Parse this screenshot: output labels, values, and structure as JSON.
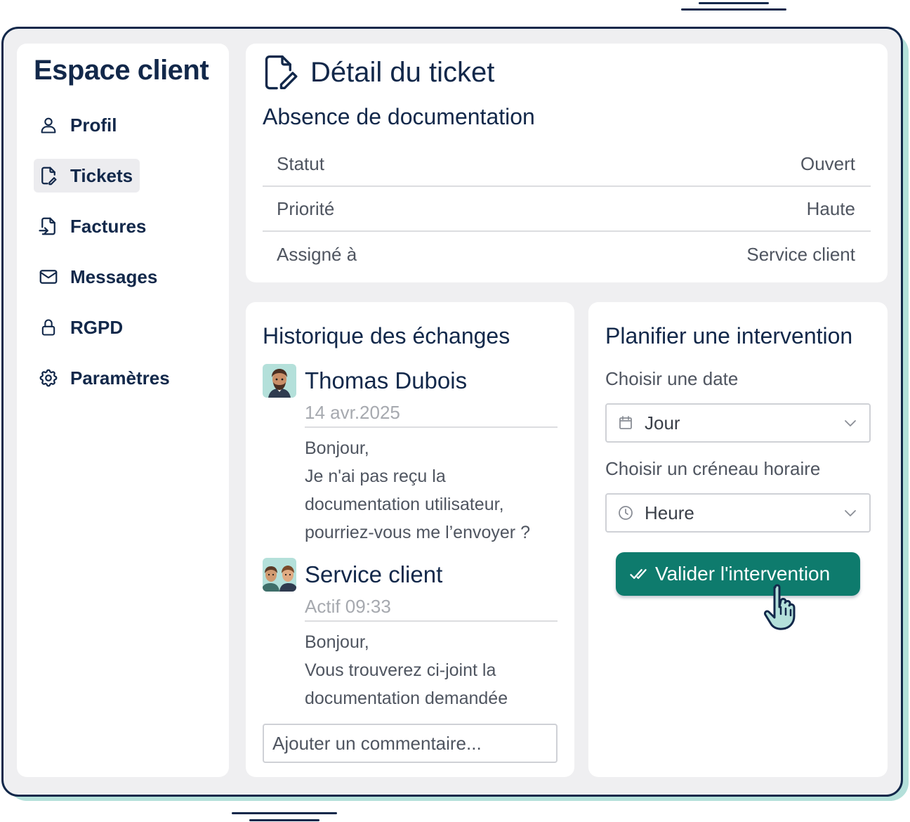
{
  "colors": {
    "navy": "#12284a",
    "accent": "#0e7b6d",
    "mint": "#b4e0da",
    "panel_bg": "#efeff1"
  },
  "sidebar": {
    "title": "Espace client",
    "items": [
      {
        "label": "Profil",
        "icon": "user-icon",
        "active": false
      },
      {
        "label": "Tickets",
        "icon": "file-edit-icon",
        "active": true
      },
      {
        "label": "Factures",
        "icon": "file-import-icon",
        "active": false
      },
      {
        "label": "Messages",
        "icon": "envelope-icon",
        "active": false
      },
      {
        "label": "RGPD",
        "icon": "lock-icon",
        "active": false
      },
      {
        "label": "Paramètres",
        "icon": "gear-icon",
        "active": false
      }
    ]
  },
  "ticket": {
    "title": "Détail du ticket",
    "subject": "Absence de documentation",
    "rows": [
      {
        "label": "Statut",
        "value": "Ouvert"
      },
      {
        "label": "Priorité",
        "value": "Haute"
      },
      {
        "label": "Assigné à",
        "value": "Service client"
      }
    ]
  },
  "history": {
    "title": "Historique des échanges",
    "messages": [
      {
        "author": "Thomas Dubois",
        "time": "14 avr.2025",
        "lines": [
          "Bonjour,",
          "Je n'ai pas reçu la",
          "documentation utilisateur,",
          "pourriez-vous me l’envoyer ?"
        ]
      },
      {
        "author": "Service client",
        "time": "Actif 09:33",
        "lines": [
          "Bonjour,",
          "Vous trouverez ci-joint la",
          "documentation demandée"
        ]
      }
    ],
    "comment_placeholder": "Ajouter un commentaire..."
  },
  "planning": {
    "title": "Planifier une intervention",
    "date_label": "Choisir une date",
    "date_value": "Jour",
    "time_label": "Choisir un créneau horaire",
    "time_value": "Heure",
    "submit_label": "Valider l'intervention"
  }
}
